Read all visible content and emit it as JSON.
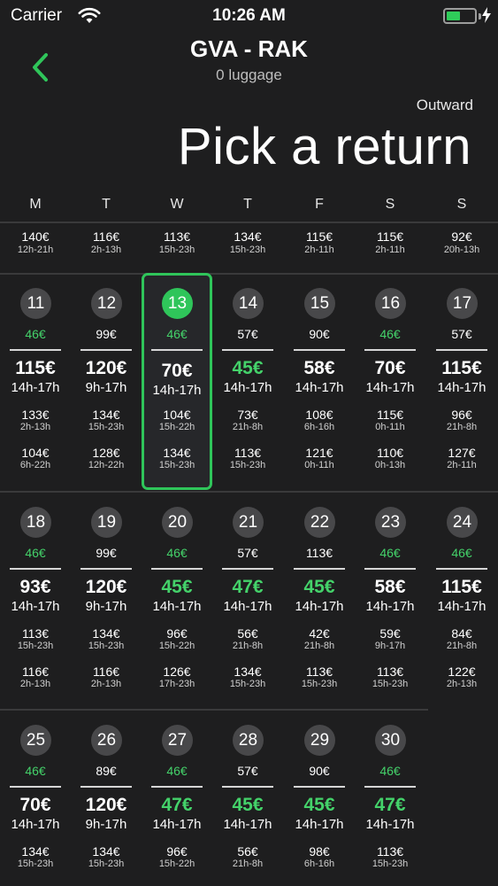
{
  "status": {
    "carrier": "Carrier",
    "time": "10:26 AM",
    "battery_level": 0.45
  },
  "header": {
    "route": "GVA - RAK",
    "luggage": "0 luggage",
    "outward_label": "Outward",
    "title": "Pick a return"
  },
  "colors": {
    "accent": "#2fc55a",
    "cheap": "#44d26a",
    "background": "#1e1e1f"
  },
  "weekdays": [
    "M",
    "T",
    "W",
    "T",
    "F",
    "S",
    "S"
  ],
  "prev_week": [
    {
      "price": "140€",
      "hours": "12h-21h"
    },
    {
      "price": "116€",
      "hours": "2h-13h"
    },
    {
      "price": "113€",
      "hours": "15h-23h"
    },
    {
      "price": "134€",
      "hours": "15h-23h"
    },
    {
      "price": "115€",
      "hours": "2h-11h"
    },
    {
      "price": "115€",
      "hours": "2h-11h"
    },
    {
      "price": "92€",
      "hours": "20h-13h"
    }
  ],
  "weeks": [
    {
      "days": [
        {
          "day": "11",
          "out_price": "46€",
          "out_cheap": true,
          "main_price": "115€",
          "main_cheap": false,
          "main_hours": "14h-17h",
          "options": [
            {
              "price": "133€",
              "hours": "2h-13h"
            },
            {
              "price": "104€",
              "hours": "6h-22h"
            }
          ]
        },
        {
          "day": "12",
          "out_price": "99€",
          "out_cheap": false,
          "main_price": "120€",
          "main_cheap": false,
          "main_hours": "9h-17h",
          "options": [
            {
              "price": "134€",
              "hours": "15h-23h"
            },
            {
              "price": "128€",
              "hours": "12h-22h"
            }
          ]
        },
        {
          "day": "13",
          "selected": true,
          "out_price": "46€",
          "out_cheap": true,
          "main_price": "70€",
          "main_cheap": false,
          "main_hours": "14h-17h",
          "options": [
            {
              "price": "104€",
              "hours": "15h-22h"
            },
            {
              "price": "134€",
              "hours": "15h-23h"
            }
          ]
        },
        {
          "day": "14",
          "out_price": "57€",
          "out_cheap": false,
          "main_price": "45€",
          "main_cheap": true,
          "main_hours": "14h-17h",
          "options": [
            {
              "price": "73€",
              "hours": "21h-8h"
            },
            {
              "price": "113€",
              "hours": "15h-23h"
            }
          ]
        },
        {
          "day": "15",
          "out_price": "90€",
          "out_cheap": false,
          "main_price": "58€",
          "main_cheap": false,
          "main_hours": "14h-17h",
          "options": [
            {
              "price": "108€",
              "hours": "6h-16h"
            },
            {
              "price": "121€",
              "hours": "0h-11h"
            }
          ]
        },
        {
          "day": "16",
          "out_price": "46€",
          "out_cheap": true,
          "main_price": "70€",
          "main_cheap": false,
          "main_hours": "14h-17h",
          "options": [
            {
              "price": "115€",
              "hours": "0h-11h"
            },
            {
              "price": "110€",
              "hours": "0h-13h"
            }
          ]
        },
        {
          "day": "17",
          "out_price": "57€",
          "out_cheap": false,
          "main_price": "115€",
          "main_cheap": false,
          "main_hours": "14h-17h",
          "options": [
            {
              "price": "96€",
              "hours": "21h-8h"
            },
            {
              "price": "127€",
              "hours": "2h-11h"
            }
          ]
        }
      ]
    },
    {
      "days": [
        {
          "day": "18",
          "out_price": "46€",
          "out_cheap": true,
          "main_price": "93€",
          "main_cheap": false,
          "main_hours": "14h-17h",
          "options": [
            {
              "price": "113€",
              "hours": "15h-23h"
            },
            {
              "price": "116€",
              "hours": "2h-13h"
            }
          ]
        },
        {
          "day": "19",
          "out_price": "99€",
          "out_cheap": false,
          "main_price": "120€",
          "main_cheap": false,
          "main_hours": "9h-17h",
          "options": [
            {
              "price": "134€",
              "hours": "15h-23h"
            },
            {
              "price": "116€",
              "hours": "2h-13h"
            }
          ]
        },
        {
          "day": "20",
          "out_price": "46€",
          "out_cheap": true,
          "main_price": "45€",
          "main_cheap": true,
          "main_hours": "14h-17h",
          "options": [
            {
              "price": "96€",
              "hours": "15h-22h"
            },
            {
              "price": "126€",
              "hours": "17h-23h"
            }
          ]
        },
        {
          "day": "21",
          "out_price": "57€",
          "out_cheap": false,
          "main_price": "47€",
          "main_cheap": true,
          "main_hours": "14h-17h",
          "options": [
            {
              "price": "56€",
              "hours": "21h-8h"
            },
            {
              "price": "134€",
              "hours": "15h-23h"
            }
          ]
        },
        {
          "day": "22",
          "out_price": "113€",
          "out_cheap": false,
          "main_price": "45€",
          "main_cheap": true,
          "main_hours": "14h-17h",
          "options": [
            {
              "price": "42€",
              "hours": "21h-8h"
            },
            {
              "price": "113€",
              "hours": "15h-23h"
            }
          ]
        },
        {
          "day": "23",
          "out_price": "46€",
          "out_cheap": true,
          "main_price": "58€",
          "main_cheap": false,
          "main_hours": "14h-17h",
          "options": [
            {
              "price": "59€",
              "hours": "9h-17h"
            },
            {
              "price": "113€",
              "hours": "15h-23h"
            }
          ]
        },
        {
          "day": "24",
          "out_price": "46€",
          "out_cheap": true,
          "main_price": "115€",
          "main_cheap": false,
          "main_hours": "14h-17h",
          "options": [
            {
              "price": "84€",
              "hours": "21h-8h"
            },
            {
              "price": "122€",
              "hours": "2h-13h"
            }
          ]
        }
      ]
    },
    {
      "days": [
        {
          "day": "25",
          "out_price": "46€",
          "out_cheap": true,
          "main_price": "70€",
          "main_cheap": false,
          "main_hours": "14h-17h",
          "options": [
            {
              "price": "134€",
              "hours": "15h-23h"
            }
          ]
        },
        {
          "day": "26",
          "out_price": "89€",
          "out_cheap": false,
          "main_price": "120€",
          "main_cheap": false,
          "main_hours": "9h-17h",
          "options": [
            {
              "price": "134€",
              "hours": "15h-23h"
            }
          ]
        },
        {
          "day": "27",
          "out_price": "46€",
          "out_cheap": true,
          "main_price": "47€",
          "main_cheap": true,
          "main_hours": "14h-17h",
          "options": [
            {
              "price": "96€",
              "hours": "15h-22h"
            }
          ]
        },
        {
          "day": "28",
          "out_price": "57€",
          "out_cheap": false,
          "main_price": "45€",
          "main_cheap": true,
          "main_hours": "14h-17h",
          "options": [
            {
              "price": "56€",
              "hours": "21h-8h"
            }
          ]
        },
        {
          "day": "29",
          "out_price": "90€",
          "out_cheap": false,
          "main_price": "45€",
          "main_cheap": true,
          "main_hours": "14h-17h",
          "options": [
            {
              "price": "98€",
              "hours": "6h-16h"
            }
          ]
        },
        {
          "day": "30",
          "out_price": "46€",
          "out_cheap": true,
          "main_price": "47€",
          "main_cheap": true,
          "main_hours": "14h-17h",
          "options": [
            {
              "price": "113€",
              "hours": "15h-23h"
            }
          ]
        }
      ]
    }
  ]
}
